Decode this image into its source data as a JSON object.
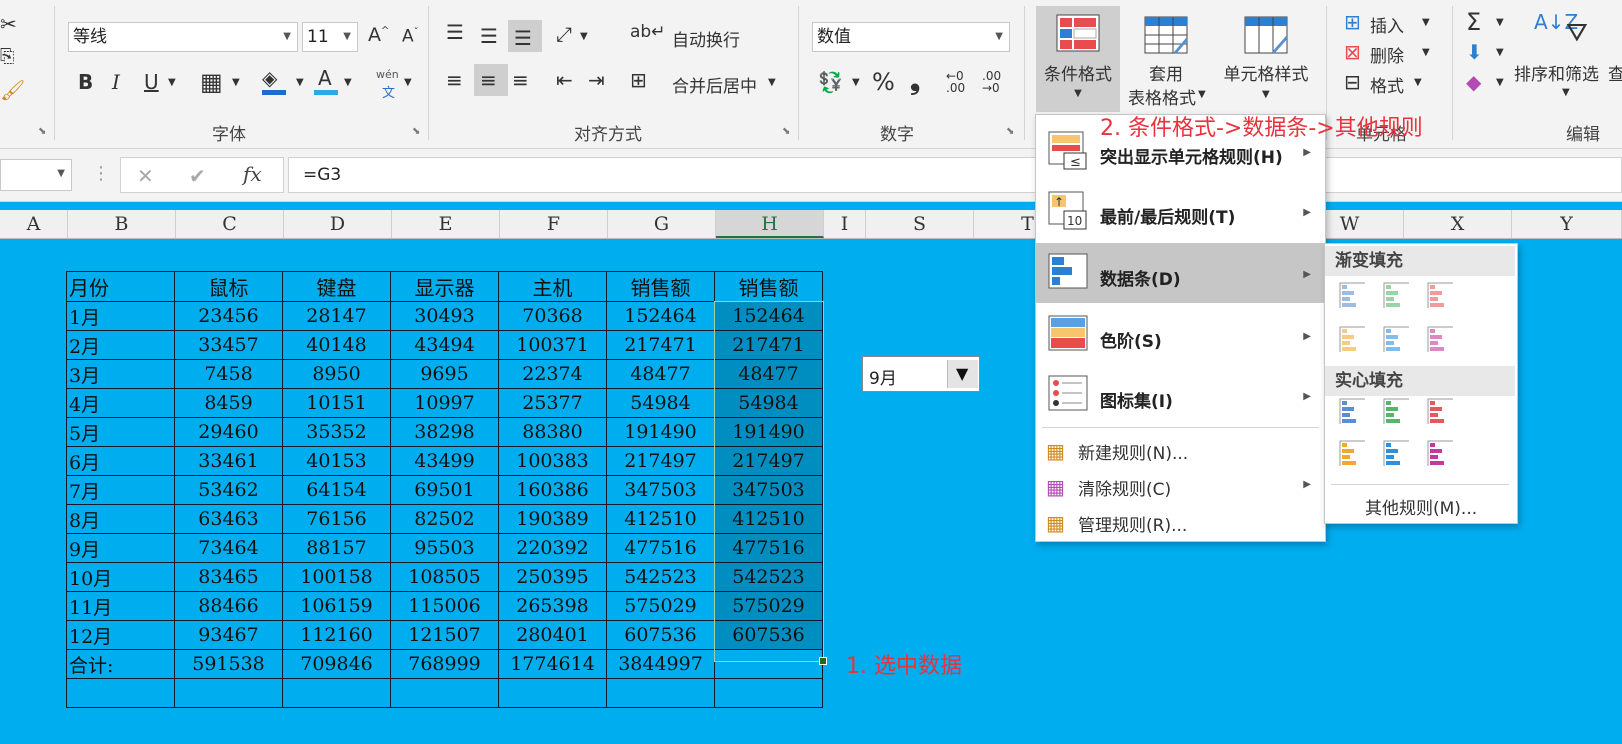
{
  "ribbon": {
    "font": {
      "name": "等线",
      "size": "11",
      "group_label": "字体",
      "bold": "B",
      "italic": "I",
      "underline": "U",
      "wen": "wén",
      "wen_sub": "文"
    },
    "align": {
      "wrap": "自动换行",
      "merge": "合并后居中",
      "group_label": "对齐方式"
    },
    "number": {
      "format": "数值",
      "group_label": "数字",
      "percent": "%",
      "comma": "❟",
      "inc": "←0\n.00",
      "dec": ".00\n→0"
    },
    "styles": {
      "conditional": "条件格式",
      "table1": "套用",
      "table2": "表格格式",
      "cell": "单元格样式"
    },
    "cells": {
      "insert": "插入",
      "delete": "删除",
      "format": "格式",
      "group_label": "单元格"
    },
    "edit": {
      "sort": "排序和筛选",
      "group_label": "编辑",
      "sigma": "Σ",
      "edge": "查"
    }
  },
  "formula_bar": {
    "formula": "=G3",
    "cancel": "✕",
    "enter": "✔",
    "fx": "fx"
  },
  "columns": [
    "A",
    "B",
    "C",
    "D",
    "E",
    "F",
    "G",
    "H",
    "I",
    "S",
    "T",
    "W",
    "X",
    "Y"
  ],
  "table": {
    "headers": [
      "月份",
      "鼠标",
      "键盘",
      "显示器",
      "主机",
      "销售额",
      "销售额"
    ],
    "rows": [
      [
        "1月",
        "23456",
        "28147",
        "30493",
        "70368",
        "152464",
        "152464"
      ],
      [
        "2月",
        "33457",
        "40148",
        "43494",
        "100371",
        "217471",
        "217471"
      ],
      [
        "3月",
        "7458",
        "8950",
        "9695",
        "22374",
        "48477",
        "48477"
      ],
      [
        "4月",
        "8459",
        "10151",
        "10997",
        "25377",
        "54984",
        "54984"
      ],
      [
        "5月",
        "29460",
        "35352",
        "38298",
        "88380",
        "191490",
        "191490"
      ],
      [
        "6月",
        "33461",
        "40153",
        "43499",
        "100383",
        "217497",
        "217497"
      ],
      [
        "7月",
        "53462",
        "64154",
        "69501",
        "160386",
        "347503",
        "347503"
      ],
      [
        "8月",
        "63463",
        "76156",
        "82502",
        "190389",
        "412510",
        "412510"
      ],
      [
        "9月",
        "73464",
        "88157",
        "95503",
        "220392",
        "477516",
        "477516"
      ],
      [
        "10月",
        "83465",
        "100158",
        "108505",
        "250395",
        "542523",
        "542523"
      ],
      [
        "11月",
        "88466",
        "106159",
        "115006",
        "265398",
        "575029",
        "575029"
      ],
      [
        "12月",
        "93467",
        "112160",
        "121507",
        "280401",
        "607536",
        "607536"
      ]
    ],
    "total": [
      "合计:",
      "591538",
      "709846",
      "768999",
      "1774614",
      "3844997",
      ""
    ]
  },
  "month_select": {
    "value": "9月"
  },
  "menu": {
    "items": [
      {
        "label": "突出显示单元格规则(H)"
      },
      {
        "label": "最前/最后规则(T)"
      },
      {
        "label": "数据条(D)"
      },
      {
        "label": "色阶(S)"
      },
      {
        "label": "图标集(I)"
      }
    ],
    "small_items": [
      {
        "label": "新建规则(N)..."
      },
      {
        "label": "清除规则(C)"
      },
      {
        "label": "管理规则(R)..."
      }
    ]
  },
  "submenu": {
    "gradient": "渐变填充",
    "solid": "实心填充",
    "other": "其他规则(M)..."
  },
  "annotations": {
    "step1": "1.  选中数据",
    "step2": "2. 条件格式->数据条->其他规则"
  },
  "colors": {
    "background": "#00adef",
    "selected_col": "#008ec0",
    "accent": "#217346",
    "annotation": "#e8323c"
  }
}
